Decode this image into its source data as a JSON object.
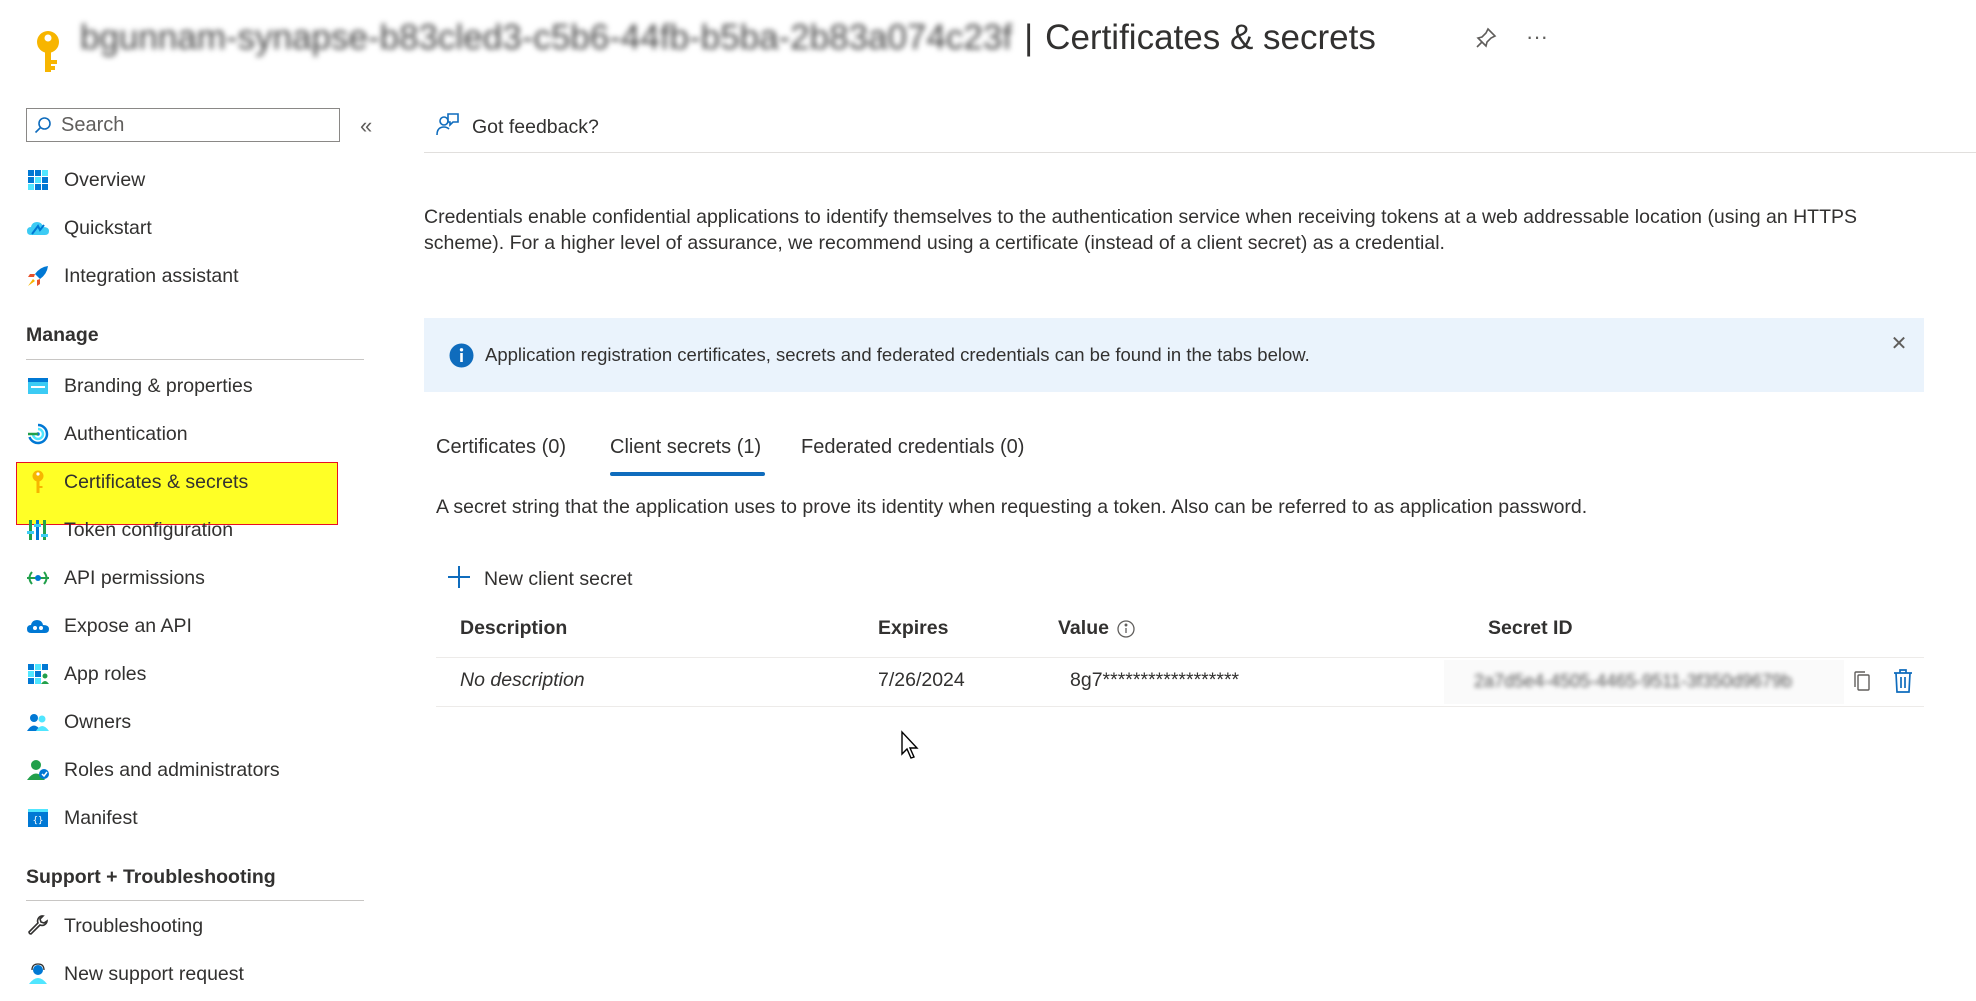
{
  "header": {
    "app_name_blurred": "bgunnam-synapse-b83cled3-c5b6-44fb-b5ba-2b83a074c23f",
    "separator": "|",
    "page_name": "Certificates & secrets",
    "more": "···"
  },
  "sidebar": {
    "search_placeholder": "Search",
    "collapse": "«",
    "top_items": [
      {
        "label": "Overview",
        "icon": "overview-grid-icon"
      },
      {
        "label": "Quickstart",
        "icon": "cloud-quickstart-icon"
      },
      {
        "label": "Integration assistant",
        "icon": "rocket-icon"
      }
    ],
    "manage_heading": "Manage",
    "manage_items": [
      {
        "label": "Branding & properties",
        "icon": "branding-icon"
      },
      {
        "label": "Authentication",
        "icon": "authentication-icon"
      },
      {
        "label": "Certificates & secrets",
        "icon": "key-icon",
        "active": true
      },
      {
        "label": "Token configuration",
        "icon": "token-config-icon"
      },
      {
        "label": "API permissions",
        "icon": "api-permissions-icon"
      },
      {
        "label": "Expose an API",
        "icon": "cloud-api-icon"
      },
      {
        "label": "App roles",
        "icon": "app-roles-icon"
      },
      {
        "label": "Owners",
        "icon": "owners-icon"
      },
      {
        "label": "Roles and administrators",
        "icon": "roles-admins-icon"
      },
      {
        "label": "Manifest",
        "icon": "manifest-icon"
      }
    ],
    "support_heading": "Support + Troubleshooting",
    "support_items": [
      {
        "label": "Troubleshooting",
        "icon": "wrench-icon"
      },
      {
        "label": "New support request",
        "icon": "support-person-icon"
      }
    ]
  },
  "command_bar": {
    "feedback_label": "Got feedback?"
  },
  "intro_text": "Credentials enable confidential applications to identify themselves to the authentication service when receiving tokens at a web addressable location (using an HTTPS scheme). For a higher level of assurance, we recommend using a certificate (instead of a client secret) as a credential.",
  "info_bar": {
    "text": "Application registration certificates, secrets and federated credentials can be found in the tabs below.",
    "close": "✕"
  },
  "tabs": [
    {
      "label": "Certificates (0)"
    },
    {
      "label": "Client secrets (1)",
      "active": true
    },
    {
      "label": "Federated credentials (0)"
    }
  ],
  "secret_description": "A secret string that the application uses to prove its identity when requesting a token. Also can be referred to as application password.",
  "new_secret_label": "New client secret",
  "table": {
    "headers": [
      "Description",
      "Expires",
      "Value",
      "Secret ID"
    ],
    "rows": [
      {
        "description": "No description",
        "expires": "7/26/2024",
        "value": "8g7******************",
        "secret_id": "2a7d5e4-4505-4465-9511-3f350d9679b"
      }
    ]
  },
  "colors": {
    "accent": "#0f6cbd",
    "highlight": "#ffff00",
    "highlight_border": "#e81123",
    "info_bg": "#eaf3fc"
  }
}
